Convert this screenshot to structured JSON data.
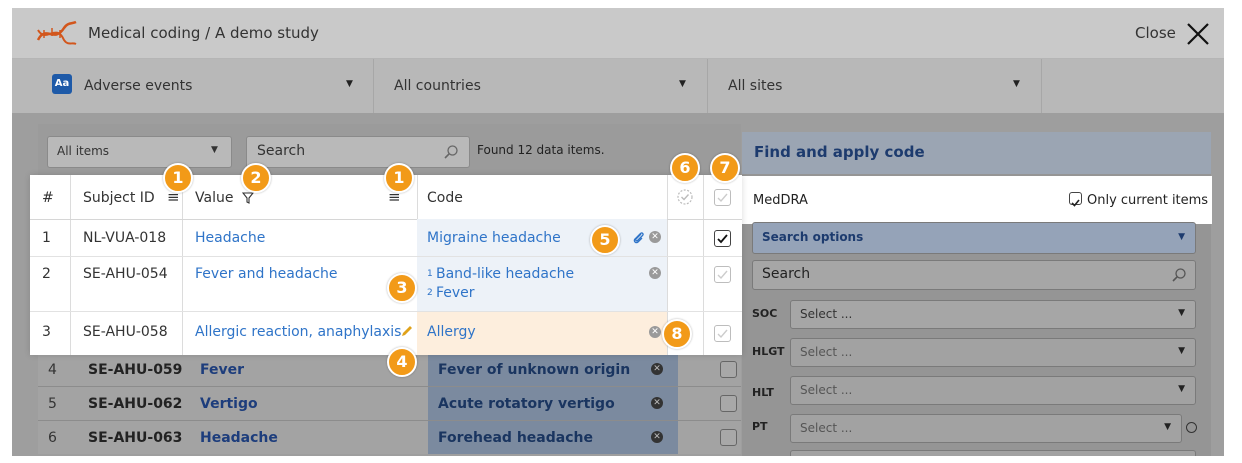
{
  "header": {
    "title": "Medical coding / A demo study",
    "close_label": "Close"
  },
  "filters": {
    "form": "Adverse events",
    "country": "All countries",
    "site": "All sites"
  },
  "toolbar": {
    "filter_value": "All items",
    "search_placeholder": "Search",
    "found_text": "Found 12 data items."
  },
  "table": {
    "headers": {
      "num": "#",
      "subject": "Subject ID",
      "value": "Value",
      "code": "Code"
    },
    "rows": [
      {
        "num": "1",
        "subject": "NL-VUA-018",
        "value": "Headache",
        "code": "Migraine headache",
        "checked": true
      },
      {
        "num": "2",
        "subject": "SE-AHU-054",
        "value": "Fever and headache",
        "code1_num": "1",
        "code1": "Band-like headache",
        "code2_num": "2",
        "code2": "Fever"
      },
      {
        "num": "3",
        "subject": "SE-AHU-058",
        "value": "Allergic reaction, anaphylaxis",
        "code": "Allergy"
      },
      {
        "num": "4",
        "subject": "SE-AHU-059",
        "value": "Fever",
        "code": "Fever of unknown origin"
      },
      {
        "num": "5",
        "subject": "SE-AHU-062",
        "value": "Vertigo",
        "code": "Acute rotatory vertigo"
      },
      {
        "num": "6",
        "subject": "SE-AHU-063",
        "value": "Headache",
        "code": "Forehead headache"
      }
    ]
  },
  "badges": [
    "1",
    "2",
    "1",
    "3",
    "4",
    "5",
    "6",
    "7",
    "8"
  ],
  "right_panel": {
    "title": "Find and apply code",
    "dictionary": "MedDRA",
    "only_current": "Only current items",
    "search_options": "Search options",
    "search_placeholder": "Search",
    "levels": [
      {
        "label": "SOC",
        "value": "Select ..."
      },
      {
        "label": "HLGT",
        "value": "Select ..."
      },
      {
        "label": "HLT",
        "value": "Select ..."
      },
      {
        "label": "PT",
        "value": "Select ..."
      }
    ]
  },
  "colors": {
    "accent": "#2f74c8",
    "badge": "#f29a18",
    "header_blue": "#1d3b6e",
    "edit_highlight": "#fdeedd"
  }
}
